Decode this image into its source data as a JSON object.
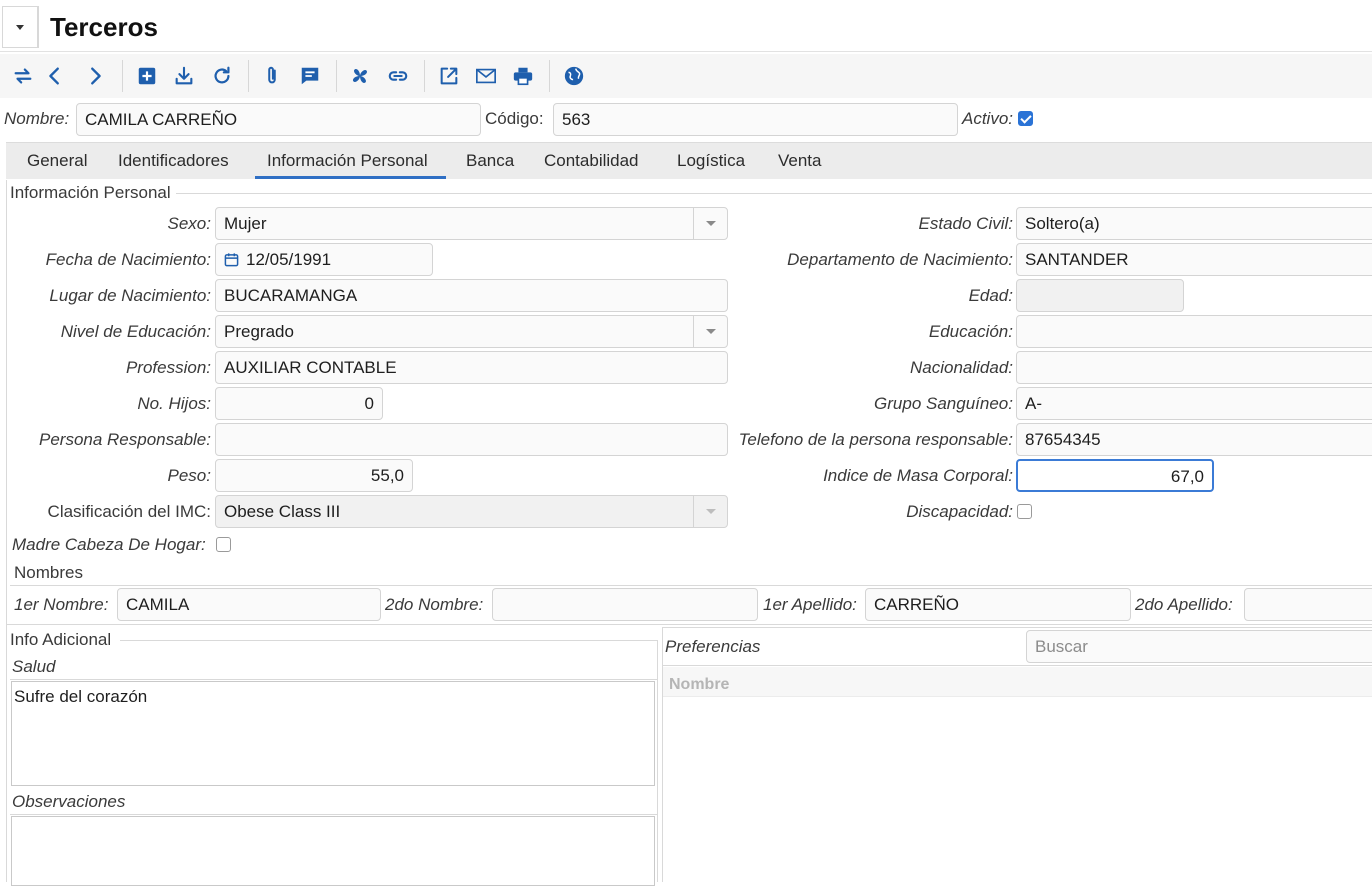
{
  "window": {
    "title": "Terceros"
  },
  "toolbar": {
    "icons": [
      "switch-icon",
      "arrow-left-icon",
      "arrow-right-icon",
      "add-icon",
      "download-icon",
      "refresh-icon",
      "attachment-icon",
      "notes-icon",
      "workflow-icon",
      "link-icon",
      "open-external-icon",
      "mail-icon",
      "print-icon",
      "globe-icon"
    ]
  },
  "header": {
    "name_label": "Nombre:",
    "name_value": "CAMILA CARREÑO",
    "code_label": "Código:",
    "code_value": "563",
    "active_label": "Activo:",
    "active_checked": true
  },
  "tabs": [
    {
      "label": "General"
    },
    {
      "label": "Identificadores"
    },
    {
      "label": "Información Personal"
    },
    {
      "label": "Banca"
    },
    {
      "label": "Contabilidad"
    },
    {
      "label": "Logística"
    },
    {
      "label": "Venta"
    }
  ],
  "active_tab": "Información Personal",
  "personal": {
    "group_title": "Información Personal",
    "sexo_label": "Sexo:",
    "sexo_value": "Mujer",
    "fecha_label": "Fecha de Nacimiento:",
    "fecha_value": "12/05/1991",
    "lugar_label": "Lugar de Nacimiento:",
    "lugar_value": "BUCARAMANGA",
    "nivel_label": "Nivel de Educación:",
    "nivel_value": "Pregrado",
    "profession_label": "Profession:",
    "profession_value": "AUXILIAR CONTABLE",
    "hijos_label": "No. Hijos:",
    "hijos_value": "0",
    "responsable_label": "Persona Responsable:",
    "responsable_value": "",
    "peso_label": "Peso:",
    "peso_value": "55,0",
    "imc_clas_label": "Clasificación del IMC:",
    "imc_clas_value": "Obese Class III",
    "madre_label": "Madre Cabeza De Hogar:",
    "madre_checked": false,
    "estado_label": "Estado Civil:",
    "estado_value": "Soltero(a)",
    "depto_label": "Departamento de Nacimiento:",
    "depto_value": "SANTANDER",
    "edad_label": "Edad:",
    "edad_value": "",
    "educacion_label": "Educación:",
    "educacion_value": "",
    "nacionalidad_label": "Nacionalidad:",
    "nacionalidad_value": "",
    "grupo_label": "Grupo Sanguíneo:",
    "grupo_value": "A-",
    "tel_resp_label": "Telefono de la persona responsable:",
    "tel_resp_value": "87654345",
    "imc_label": "Indice de Masa Corporal:",
    "imc_value": "67,0",
    "discapacidad_label": "Discapacidad:",
    "discapacidad_checked": false
  },
  "nombres": {
    "group_title": "Nombres",
    "n1_label": "1er Nombre:",
    "n1_value": "CAMILA",
    "n2_label": "2do Nombre:",
    "n2_value": "",
    "a1_label": "1er Apellido:",
    "a1_value": "CARREÑO",
    "a2_label": "2do Apellido:",
    "a2_value": ""
  },
  "info": {
    "group_title": "Info Adicional",
    "salud_label": "Salud",
    "salud_value": "Sufre del corazón",
    "obs_label": "Observaciones",
    "obs_value": ""
  },
  "preferencias": {
    "label": "Preferencias",
    "search_placeholder": "Buscar",
    "column_header": "Nombre"
  }
}
